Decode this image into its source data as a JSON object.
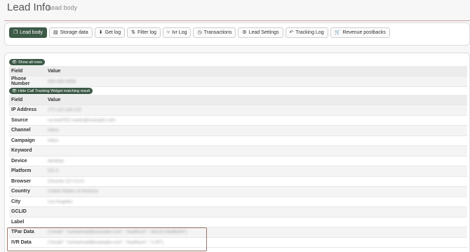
{
  "header": {
    "title": "Lead Info",
    "subtitle": "Lead body"
  },
  "tabs": [
    {
      "label": "Lead body",
      "icon": "copy-icon",
      "glyph": "❐",
      "active": true
    },
    {
      "label": "Storage data",
      "icon": "storage-icon",
      "glyph": "▤"
    },
    {
      "label": "Get log",
      "icon": "download-icon",
      "glyph": "⬇"
    },
    {
      "label": "Filter log",
      "icon": "filter-icon",
      "glyph": "⇅"
    },
    {
      "label": "Ivr Log",
      "icon": "branch-icon",
      "glyph": "⑂"
    },
    {
      "label": "Transactions",
      "icon": "clock-icon",
      "glyph": "◷"
    },
    {
      "label": "Lead Settings",
      "icon": "gear-icon",
      "glyph": "⚙"
    },
    {
      "label": "Tracking Log",
      "icon": "reply-icon",
      "glyph": "↶"
    },
    {
      "label": "Revenue postbacks",
      "icon": "cart-icon",
      "glyph": "🛒"
    }
  ],
  "show_all_rows": {
    "label": "Show all rows",
    "glyph": "👁"
  },
  "hide_widget": {
    "label": "Hide Call Tracking Widget matching result",
    "glyph": "👁"
  },
  "table1": {
    "columns": [
      "Field",
      "Value"
    ],
    "rows": [
      {
        "field": "Phone Number",
        "value": "555-555-5555"
      }
    ]
  },
  "table2": {
    "columns": [
      "Field",
      "Value"
    ],
    "rows": [
      {
        "field": "IP Address",
        "value": "172.115.118.120"
      },
      {
        "field": "Source",
        "value": "ca.leadTEC.leads@example.com"
      },
      {
        "field": "Channel",
        "value": "inbox"
      },
      {
        "field": "Campaign",
        "value": "inbox"
      },
      {
        "field": "Keyword",
        "value": ""
      },
      {
        "field": "Device",
        "value": "desktop"
      },
      {
        "field": "Platform",
        "value": "OS X"
      },
      {
        "field": "Browser",
        "value": "Chrome 117.0.0.0"
      },
      {
        "field": "Country",
        "value": "United States of America"
      },
      {
        "field": "City",
        "value": "Los Angeles"
      },
      {
        "field": "GCLID",
        "value": ""
      },
      {
        "field": "Label",
        "value": ""
      },
      {
        "field": "TPar Data",
        "value": "{\"email\": \"someemail@example.com\", \"leadNum\": \"abc3214bd8d2b\"}"
      },
      {
        "field": "IVR Data",
        "value": "{\"email\": \"someemail@example.com\", \"leadNum\": \"1.00\"}"
      }
    ]
  },
  "colors": {
    "accent": "#3d5a47",
    "highlight": "#a0766a"
  }
}
